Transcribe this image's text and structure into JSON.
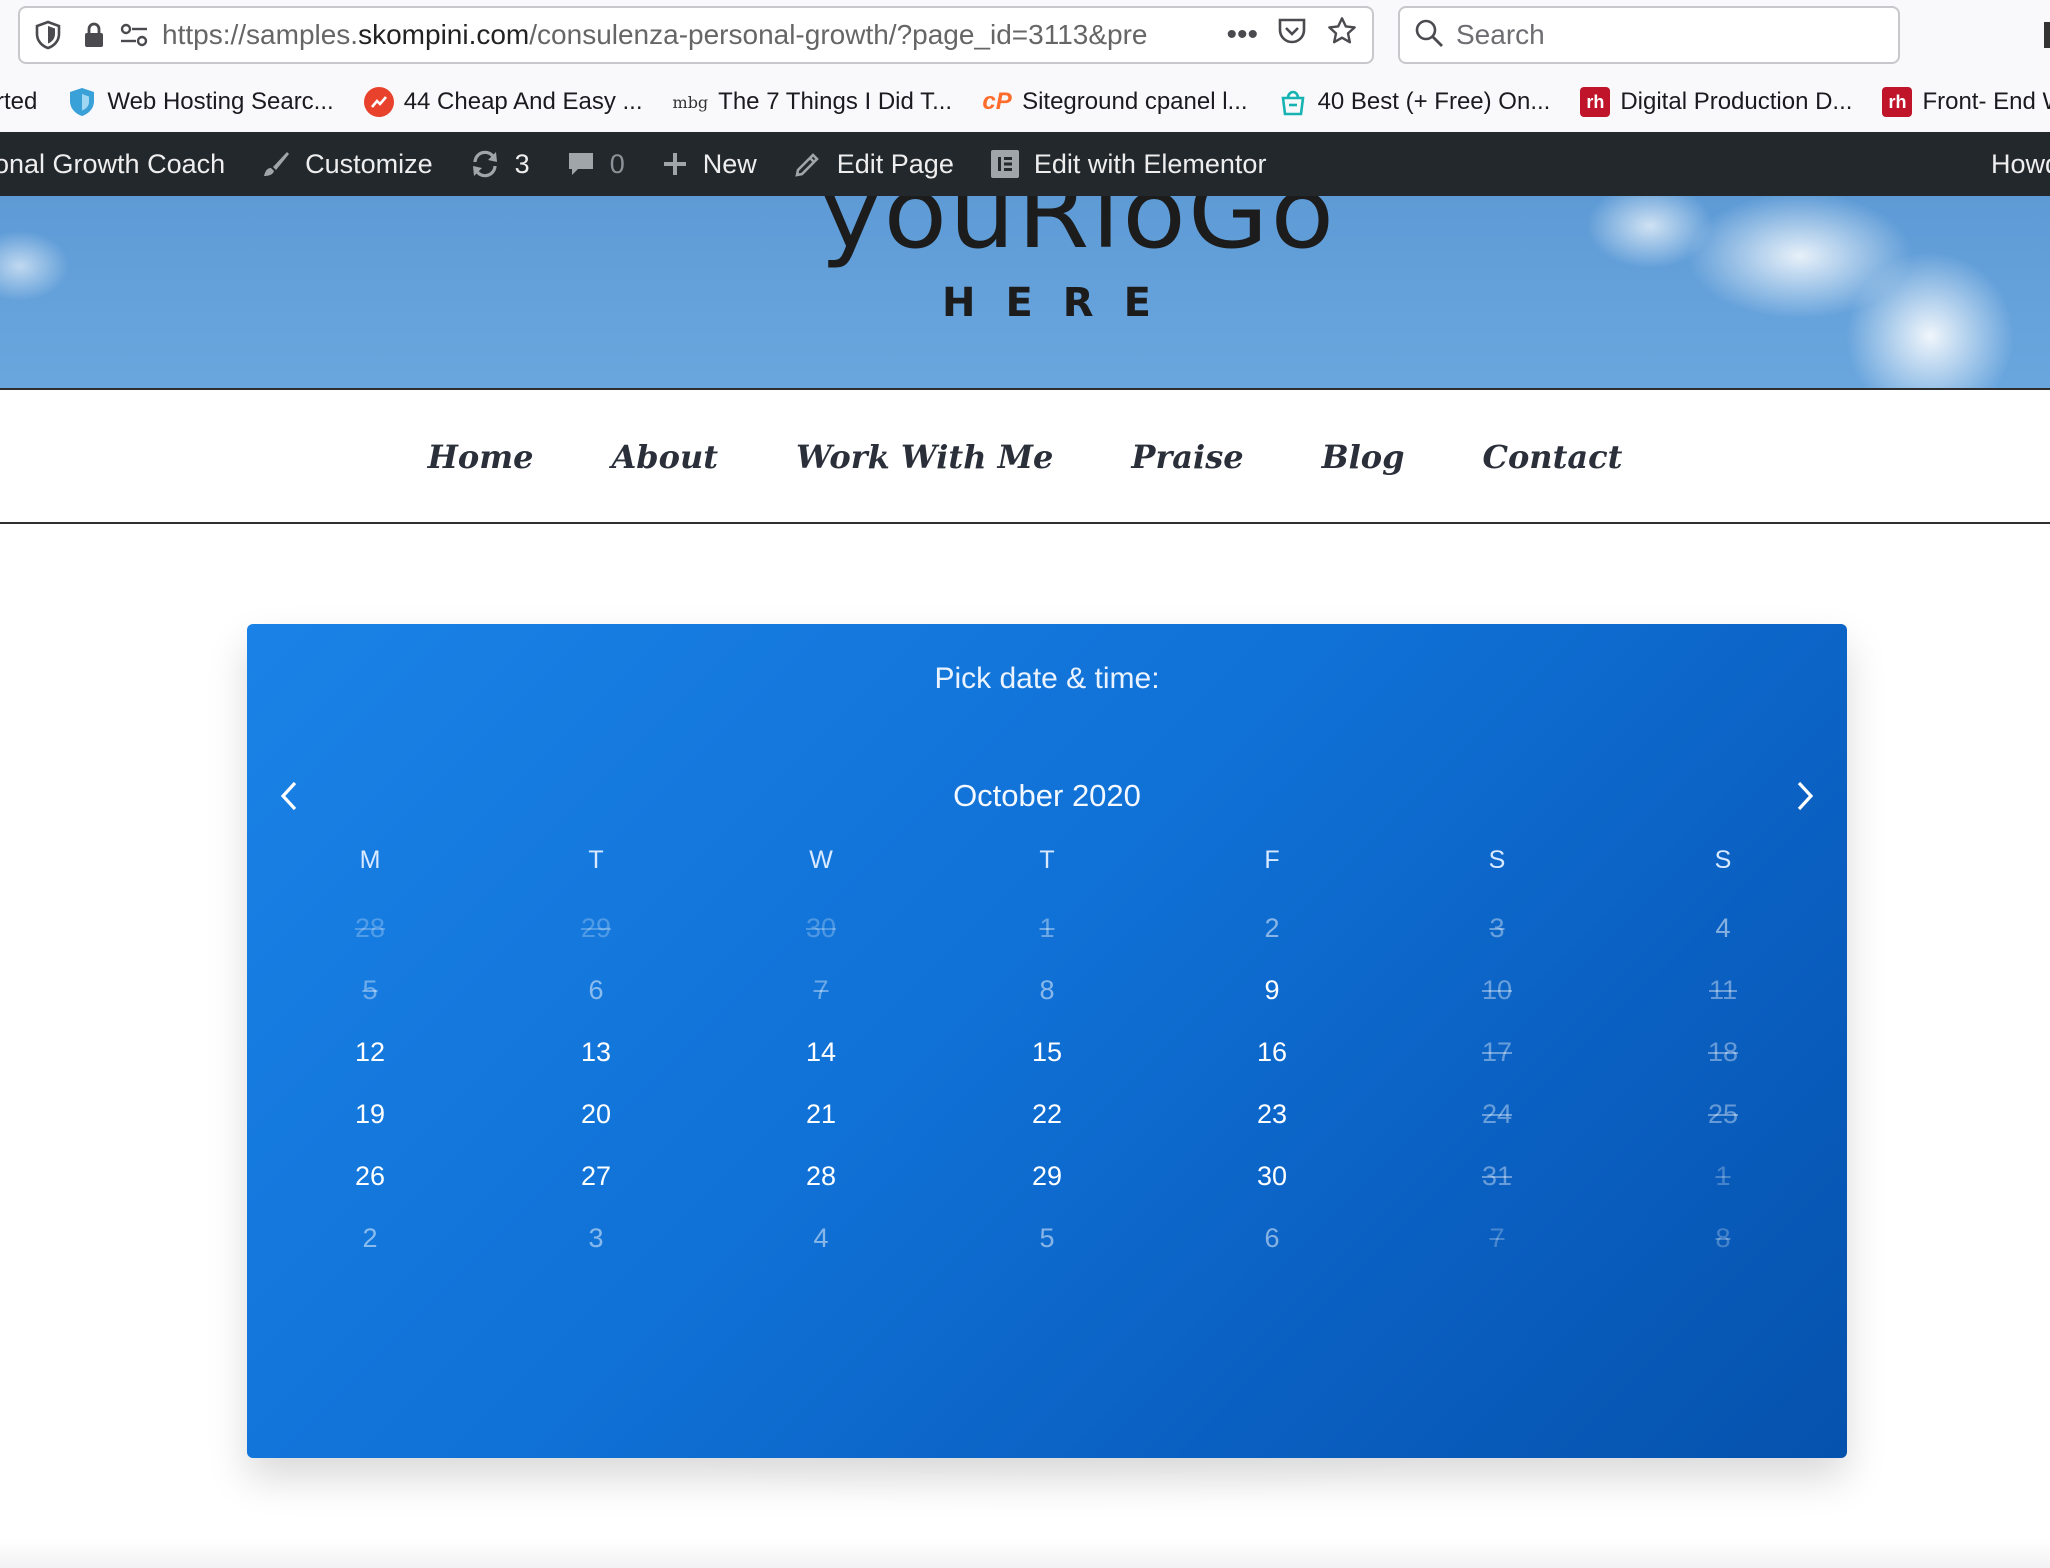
{
  "browser": {
    "url_prefix": "https://samples.",
    "url_host": "skompini.com",
    "url_path": "/consulenza-personal-growth/?page_id=3113&pre",
    "search_placeholder": "Search"
  },
  "bookmarks": [
    {
      "label": "rted",
      "icon": "none"
    },
    {
      "label": "Web Hosting Searc...",
      "icon": "shield-bookmark-icon",
      "color": "#3aa0d8"
    },
    {
      "label": "44 Cheap And Easy ...",
      "icon": "trending-up-icon",
      "color": "#e8412c"
    },
    {
      "label": "The 7 Things I Did T...",
      "icon": "mbg-logo",
      "text": "mbg"
    },
    {
      "label": "Siteground cpanel l...",
      "icon": "cpanel-icon",
      "color": "#ff6c2c"
    },
    {
      "label": "40 Best (+ Free) On...",
      "icon": "shopping-bag-icon",
      "color": "#17b3b3"
    },
    {
      "label": "Digital Production D...",
      "icon": "rh-logo",
      "color": "#c0142a",
      "text": "rh"
    },
    {
      "label": "Front- End Web I",
      "icon": "rh-logo",
      "color": "#c0142a",
      "text": "rh"
    }
  ],
  "wpbar": {
    "site": "onal Growth Coach",
    "customize": "Customize",
    "updates": "3",
    "comments": "0",
    "new": "New",
    "edit_page": "Edit Page",
    "elementor": "Edit with Elementor",
    "howdy": "Howd"
  },
  "header": {
    "logo_top": "youRloGo",
    "logo_bottom": "HERE"
  },
  "nav": [
    "Home",
    "About",
    "Work With Me",
    "Praise",
    "Blog",
    "Contact"
  ],
  "calendar": {
    "title": "Pick date & time:",
    "month": "October 2020",
    "weekdays": [
      "M",
      "T",
      "W",
      "T",
      "F",
      "S",
      "S"
    ],
    "weeks": [
      [
        {
          "d": "28",
          "s": "faint"
        },
        {
          "d": "29",
          "s": "faint"
        },
        {
          "d": "30",
          "s": "faint"
        },
        {
          "d": "1",
          "s": "disabled"
        },
        {
          "d": "2",
          "s": "muted"
        },
        {
          "d": "3",
          "s": "disabled"
        },
        {
          "d": "4",
          "s": "muted"
        }
      ],
      [
        {
          "d": "5",
          "s": "disabled"
        },
        {
          "d": "6",
          "s": "muted"
        },
        {
          "d": "7",
          "s": "disabled"
        },
        {
          "d": "8",
          "s": "muted"
        },
        {
          "d": "9",
          "s": "active"
        },
        {
          "d": "10",
          "s": "disabled"
        },
        {
          "d": "11",
          "s": "disabled"
        }
      ],
      [
        {
          "d": "12",
          "s": "active"
        },
        {
          "d": "13",
          "s": "active"
        },
        {
          "d": "14",
          "s": "active"
        },
        {
          "d": "15",
          "s": "active"
        },
        {
          "d": "16",
          "s": "active"
        },
        {
          "d": "17",
          "s": "disabled"
        },
        {
          "d": "18",
          "s": "disabled"
        }
      ],
      [
        {
          "d": "19",
          "s": "active"
        },
        {
          "d": "20",
          "s": "active"
        },
        {
          "d": "21",
          "s": "active"
        },
        {
          "d": "22",
          "s": "active"
        },
        {
          "d": "23",
          "s": "active"
        },
        {
          "d": "24",
          "s": "disabled"
        },
        {
          "d": "25",
          "s": "disabled"
        }
      ],
      [
        {
          "d": "26",
          "s": "active"
        },
        {
          "d": "27",
          "s": "active"
        },
        {
          "d": "28",
          "s": "active"
        },
        {
          "d": "29",
          "s": "active"
        },
        {
          "d": "30",
          "s": "active"
        },
        {
          "d": "31",
          "s": "disabled"
        },
        {
          "d": "1",
          "s": "faint"
        }
      ],
      [
        {
          "d": "2",
          "s": "muted"
        },
        {
          "d": "3",
          "s": "muted"
        },
        {
          "d": "4",
          "s": "muted"
        },
        {
          "d": "5",
          "s": "muted"
        },
        {
          "d": "6",
          "s": "muted"
        },
        {
          "d": "7",
          "s": "faint"
        },
        {
          "d": "8",
          "s": "faint"
        }
      ]
    ]
  }
}
